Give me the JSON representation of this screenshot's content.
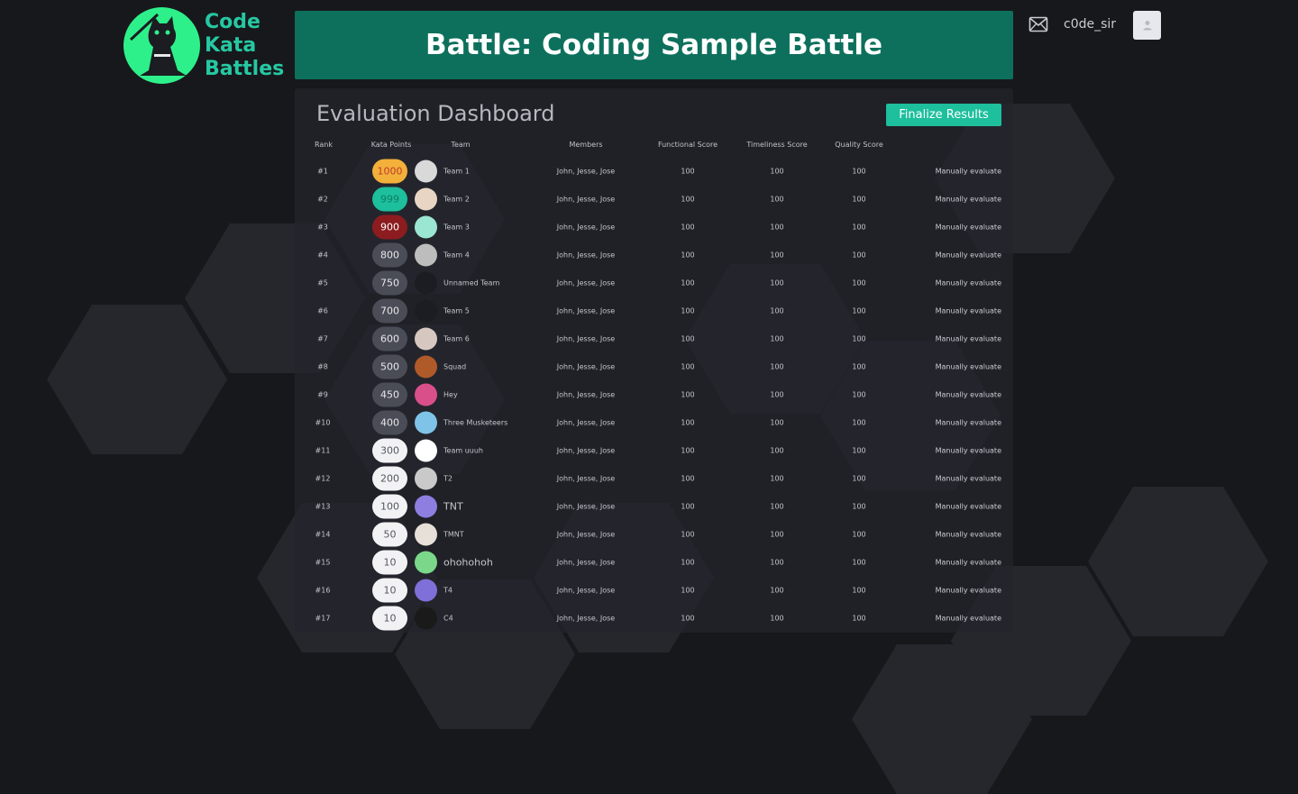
{
  "brand": {
    "logo_lines": [
      "Code",
      "Kata",
      "Battles"
    ]
  },
  "header": {
    "title": "Battle: Coding Sample Battle"
  },
  "user": {
    "username": "c0de_sir"
  },
  "dashboard": {
    "title": "Evaluation Dashboard",
    "finalize_label": "Finalize Results",
    "columns": {
      "rank": "Rank",
      "kata_points": "Kata Points",
      "team": "Team",
      "members": "Members",
      "functional": "Functional Score",
      "timeliness": "Timeliness Score",
      "quality": "Quality Score"
    },
    "rows": [
      {
        "rank": "#1",
        "points": "1000",
        "team": "Team 1",
        "members": "John, Jesse, Jose",
        "functional": "100",
        "timeliness": "100",
        "quality": "100",
        "action": "Manually evaluate"
      },
      {
        "rank": "#2",
        "points": "999",
        "team": "Team 2",
        "members": "John, Jesse, Jose",
        "functional": "100",
        "timeliness": "100",
        "quality": "100",
        "action": "Manually evaluate"
      },
      {
        "rank": "#3",
        "points": "900",
        "team": "Team 3",
        "members": "John, Jesse, Jose",
        "functional": "100",
        "timeliness": "100",
        "quality": "100",
        "action": "Manually evaluate"
      },
      {
        "rank": "#4",
        "points": "800",
        "team": "Team 4",
        "members": "John, Jesse, Jose",
        "functional": "100",
        "timeliness": "100",
        "quality": "100",
        "action": "Manually evaluate"
      },
      {
        "rank": "#5",
        "points": "750",
        "team": "Unnamed Team",
        "members": "John, Jesse, Jose",
        "functional": "100",
        "timeliness": "100",
        "quality": "100",
        "action": "Manually evaluate"
      },
      {
        "rank": "#6",
        "points": "700",
        "team": "Team 5",
        "members": "John, Jesse, Jose",
        "functional": "100",
        "timeliness": "100",
        "quality": "100",
        "action": "Manually evaluate"
      },
      {
        "rank": "#7",
        "points": "600",
        "team": "Team 6",
        "members": "John, Jesse, Jose",
        "functional": "100",
        "timeliness": "100",
        "quality": "100",
        "action": "Manually evaluate"
      },
      {
        "rank": "#8",
        "points": "500",
        "team": "Squad",
        "members": "John, Jesse, Jose",
        "functional": "100",
        "timeliness": "100",
        "quality": "100",
        "action": "Manually evaluate"
      },
      {
        "rank": "#9",
        "points": "450",
        "team": "Hey",
        "members": "John, Jesse, Jose",
        "functional": "100",
        "timeliness": "100",
        "quality": "100",
        "action": "Manually evaluate"
      },
      {
        "rank": "#10",
        "points": "400",
        "team": "Three Musketeers",
        "members": "John, Jesse, Jose",
        "functional": "100",
        "timeliness": "100",
        "quality": "100",
        "action": "Manually evaluate"
      },
      {
        "rank": "#11",
        "points": "300",
        "team": "Team uuuh",
        "members": "John, Jesse, Jose",
        "functional": "100",
        "timeliness": "100",
        "quality": "100",
        "action": "Manually evaluate"
      },
      {
        "rank": "#12",
        "points": "200",
        "team": "T2",
        "members": "John, Jesse, Jose",
        "functional": "100",
        "timeliness": "100",
        "quality": "100",
        "action": "Manually evaluate"
      },
      {
        "rank": "#13",
        "points": "100",
        "team": "TNT",
        "members": "John, Jesse, Jose",
        "functional": "100",
        "timeliness": "100",
        "quality": "100",
        "action": "Manually evaluate"
      },
      {
        "rank": "#14",
        "points": "50",
        "team": "TMNT",
        "members": "John, Jesse, Jose",
        "functional": "100",
        "timeliness": "100",
        "quality": "100",
        "action": "Manually evaluate"
      },
      {
        "rank": "#15",
        "points": "10",
        "team": "ohohohoh",
        "members": "John, Jesse, Jose",
        "functional": "100",
        "timeliness": "100",
        "quality": "100",
        "action": "Manually evaluate"
      },
      {
        "rank": "#16",
        "points": "10",
        "team": "T4",
        "members": "John, Jesse, Jose",
        "functional": "100",
        "timeliness": "100",
        "quality": "100",
        "action": "Manually evaluate"
      },
      {
        "rank": "#17",
        "points": "10",
        "team": "C4",
        "members": "John, Jesse, Jose",
        "functional": "100",
        "timeliness": "100",
        "quality": "100",
        "action": "Manually evaluate"
      }
    ]
  },
  "colors": {
    "header_bg": "#0d705c",
    "accent": "#1dbf9c",
    "brand_text": "#26c8a2",
    "logo_bg": "#2ef08a",
    "rank1_pill": "#f3b13b",
    "rank2_pill": "#1dbf9c",
    "rank3_pill": "#8c1c1f",
    "mid_pill": "#4a4d56",
    "low_pill": "#f2f2f4"
  }
}
